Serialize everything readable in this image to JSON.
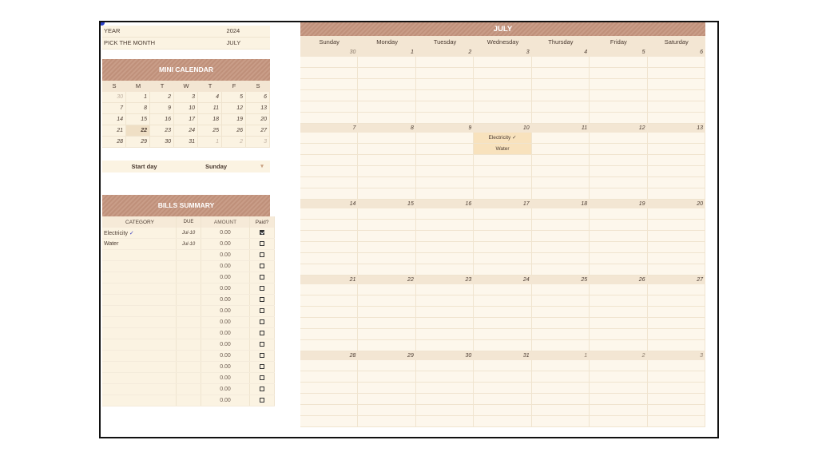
{
  "settings": {
    "year_label": "YEAR",
    "year_value": "2024",
    "month_label": "PICK THE MONTH",
    "month_value": "JULY"
  },
  "mini_calendar": {
    "title": "MINI CALENDAR",
    "days": [
      "S",
      "M",
      "T",
      "W",
      "T",
      "F",
      "S"
    ],
    "weeks": [
      [
        "30",
        "1",
        "2",
        "3",
        "4",
        "5",
        "6"
      ],
      [
        "7",
        "8",
        "9",
        "10",
        "11",
        "12",
        "13"
      ],
      [
        "14",
        "15",
        "16",
        "17",
        "18",
        "19",
        "20"
      ],
      [
        "21",
        "22",
        "23",
        "24",
        "25",
        "26",
        "27"
      ],
      [
        "28",
        "29",
        "30",
        "31",
        "1",
        "2",
        "3"
      ]
    ],
    "highlight": "22"
  },
  "start_day": {
    "label": "Start day",
    "value": "Sunday",
    "caret": "▾"
  },
  "bills": {
    "title": "BILLS SUMMARY",
    "headers": {
      "category": "CATEGORY",
      "due": "DUE",
      "amount": "AMOUNT",
      "paid": "Paid?"
    },
    "rows": [
      {
        "category": "Electricity",
        "tick": "✓",
        "due": "Jul-10",
        "amount": "0.00",
        "paid": true
      },
      {
        "category": "Water",
        "tick": "",
        "due": "Jul-10",
        "amount": "0.00",
        "paid": false
      },
      {
        "category": "",
        "tick": "",
        "due": "",
        "amount": "0.00",
        "paid": false
      },
      {
        "category": "",
        "tick": "",
        "due": "",
        "amount": "0.00",
        "paid": false
      },
      {
        "category": "",
        "tick": "",
        "due": "",
        "amount": "0.00",
        "paid": false
      },
      {
        "category": "",
        "tick": "",
        "due": "",
        "amount": "0.00",
        "paid": false
      },
      {
        "category": "",
        "tick": "",
        "due": "",
        "amount": "0.00",
        "paid": false
      },
      {
        "category": "",
        "tick": "",
        "due": "",
        "amount": "0.00",
        "paid": false
      },
      {
        "category": "",
        "tick": "",
        "due": "",
        "amount": "0.00",
        "paid": false
      },
      {
        "category": "",
        "tick": "",
        "due": "",
        "amount": "0.00",
        "paid": false
      },
      {
        "category": "",
        "tick": "",
        "due": "",
        "amount": "0.00",
        "paid": false
      },
      {
        "category": "",
        "tick": "",
        "due": "",
        "amount": "0.00",
        "paid": false
      },
      {
        "category": "",
        "tick": "",
        "due": "",
        "amount": "0.00",
        "paid": false
      },
      {
        "category": "",
        "tick": "",
        "due": "",
        "amount": "0.00",
        "paid": false
      },
      {
        "category": "",
        "tick": "",
        "due": "",
        "amount": "0.00",
        "paid": false
      },
      {
        "category": "",
        "tick": "",
        "due": "",
        "amount": "0.00",
        "paid": false
      }
    ]
  },
  "calendar": {
    "month_title": "JULY",
    "weekdays": [
      "Sunday",
      "Monday",
      "Tuesday",
      "Wednesday",
      "Thursday",
      "Friday",
      "Saturday"
    ],
    "weeks": [
      [
        "30",
        "1",
        "2",
        "3",
        "4",
        "5",
        "6"
      ],
      [
        "7",
        "8",
        "9",
        "10",
        "11",
        "12",
        "13"
      ],
      [
        "14",
        "15",
        "16",
        "17",
        "18",
        "19",
        "20"
      ],
      [
        "21",
        "22",
        "23",
        "24",
        "25",
        "26",
        "27"
      ],
      [
        "28",
        "29",
        "30",
        "31",
        "1",
        "2",
        "3"
      ]
    ],
    "events": [
      {
        "week": 1,
        "day": 3,
        "slot": 0,
        "text": "Electricity ✓"
      },
      {
        "week": 1,
        "day": 3,
        "slot": 1,
        "text": "Water"
      }
    ]
  },
  "colors": {
    "header_brown": "#bf907a",
    "cell_cream": "#fdf7ec",
    "event_highlight": "#f8e2bd",
    "check_blue": "#3b3fc0"
  }
}
